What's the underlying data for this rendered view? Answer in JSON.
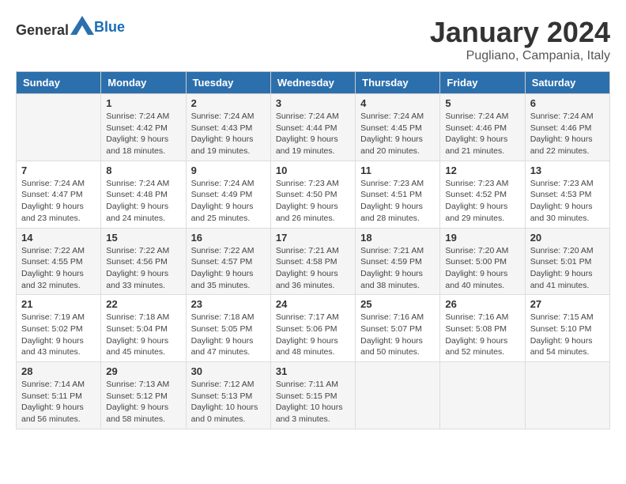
{
  "header": {
    "logo_general": "General",
    "logo_blue": "Blue",
    "month_title": "January 2024",
    "location": "Pugliano, Campania, Italy"
  },
  "days_of_week": [
    "Sunday",
    "Monday",
    "Tuesday",
    "Wednesday",
    "Thursday",
    "Friday",
    "Saturday"
  ],
  "weeks": [
    [
      {
        "day": "",
        "info": ""
      },
      {
        "day": "1",
        "info": "Sunrise: 7:24 AM\nSunset: 4:42 PM\nDaylight: 9 hours\nand 18 minutes."
      },
      {
        "day": "2",
        "info": "Sunrise: 7:24 AM\nSunset: 4:43 PM\nDaylight: 9 hours\nand 19 minutes."
      },
      {
        "day": "3",
        "info": "Sunrise: 7:24 AM\nSunset: 4:44 PM\nDaylight: 9 hours\nand 19 minutes."
      },
      {
        "day": "4",
        "info": "Sunrise: 7:24 AM\nSunset: 4:45 PM\nDaylight: 9 hours\nand 20 minutes."
      },
      {
        "day": "5",
        "info": "Sunrise: 7:24 AM\nSunset: 4:46 PM\nDaylight: 9 hours\nand 21 minutes."
      },
      {
        "day": "6",
        "info": "Sunrise: 7:24 AM\nSunset: 4:46 PM\nDaylight: 9 hours\nand 22 minutes."
      }
    ],
    [
      {
        "day": "7",
        "info": "Sunrise: 7:24 AM\nSunset: 4:47 PM\nDaylight: 9 hours\nand 23 minutes."
      },
      {
        "day": "8",
        "info": "Sunrise: 7:24 AM\nSunset: 4:48 PM\nDaylight: 9 hours\nand 24 minutes."
      },
      {
        "day": "9",
        "info": "Sunrise: 7:24 AM\nSunset: 4:49 PM\nDaylight: 9 hours\nand 25 minutes."
      },
      {
        "day": "10",
        "info": "Sunrise: 7:23 AM\nSunset: 4:50 PM\nDaylight: 9 hours\nand 26 minutes."
      },
      {
        "day": "11",
        "info": "Sunrise: 7:23 AM\nSunset: 4:51 PM\nDaylight: 9 hours\nand 28 minutes."
      },
      {
        "day": "12",
        "info": "Sunrise: 7:23 AM\nSunset: 4:52 PM\nDaylight: 9 hours\nand 29 minutes."
      },
      {
        "day": "13",
        "info": "Sunrise: 7:23 AM\nSunset: 4:53 PM\nDaylight: 9 hours\nand 30 minutes."
      }
    ],
    [
      {
        "day": "14",
        "info": "Sunrise: 7:22 AM\nSunset: 4:55 PM\nDaylight: 9 hours\nand 32 minutes."
      },
      {
        "day": "15",
        "info": "Sunrise: 7:22 AM\nSunset: 4:56 PM\nDaylight: 9 hours\nand 33 minutes."
      },
      {
        "day": "16",
        "info": "Sunrise: 7:22 AM\nSunset: 4:57 PM\nDaylight: 9 hours\nand 35 minutes."
      },
      {
        "day": "17",
        "info": "Sunrise: 7:21 AM\nSunset: 4:58 PM\nDaylight: 9 hours\nand 36 minutes."
      },
      {
        "day": "18",
        "info": "Sunrise: 7:21 AM\nSunset: 4:59 PM\nDaylight: 9 hours\nand 38 minutes."
      },
      {
        "day": "19",
        "info": "Sunrise: 7:20 AM\nSunset: 5:00 PM\nDaylight: 9 hours\nand 40 minutes."
      },
      {
        "day": "20",
        "info": "Sunrise: 7:20 AM\nSunset: 5:01 PM\nDaylight: 9 hours\nand 41 minutes."
      }
    ],
    [
      {
        "day": "21",
        "info": "Sunrise: 7:19 AM\nSunset: 5:02 PM\nDaylight: 9 hours\nand 43 minutes."
      },
      {
        "day": "22",
        "info": "Sunrise: 7:18 AM\nSunset: 5:04 PM\nDaylight: 9 hours\nand 45 minutes."
      },
      {
        "day": "23",
        "info": "Sunrise: 7:18 AM\nSunset: 5:05 PM\nDaylight: 9 hours\nand 47 minutes."
      },
      {
        "day": "24",
        "info": "Sunrise: 7:17 AM\nSunset: 5:06 PM\nDaylight: 9 hours\nand 48 minutes."
      },
      {
        "day": "25",
        "info": "Sunrise: 7:16 AM\nSunset: 5:07 PM\nDaylight: 9 hours\nand 50 minutes."
      },
      {
        "day": "26",
        "info": "Sunrise: 7:16 AM\nSunset: 5:08 PM\nDaylight: 9 hours\nand 52 minutes."
      },
      {
        "day": "27",
        "info": "Sunrise: 7:15 AM\nSunset: 5:10 PM\nDaylight: 9 hours\nand 54 minutes."
      }
    ],
    [
      {
        "day": "28",
        "info": "Sunrise: 7:14 AM\nSunset: 5:11 PM\nDaylight: 9 hours\nand 56 minutes."
      },
      {
        "day": "29",
        "info": "Sunrise: 7:13 AM\nSunset: 5:12 PM\nDaylight: 9 hours\nand 58 minutes."
      },
      {
        "day": "30",
        "info": "Sunrise: 7:12 AM\nSunset: 5:13 PM\nDaylight: 10 hours\nand 0 minutes."
      },
      {
        "day": "31",
        "info": "Sunrise: 7:11 AM\nSunset: 5:15 PM\nDaylight: 10 hours\nand 3 minutes."
      },
      {
        "day": "",
        "info": ""
      },
      {
        "day": "",
        "info": ""
      },
      {
        "day": "",
        "info": ""
      }
    ]
  ]
}
